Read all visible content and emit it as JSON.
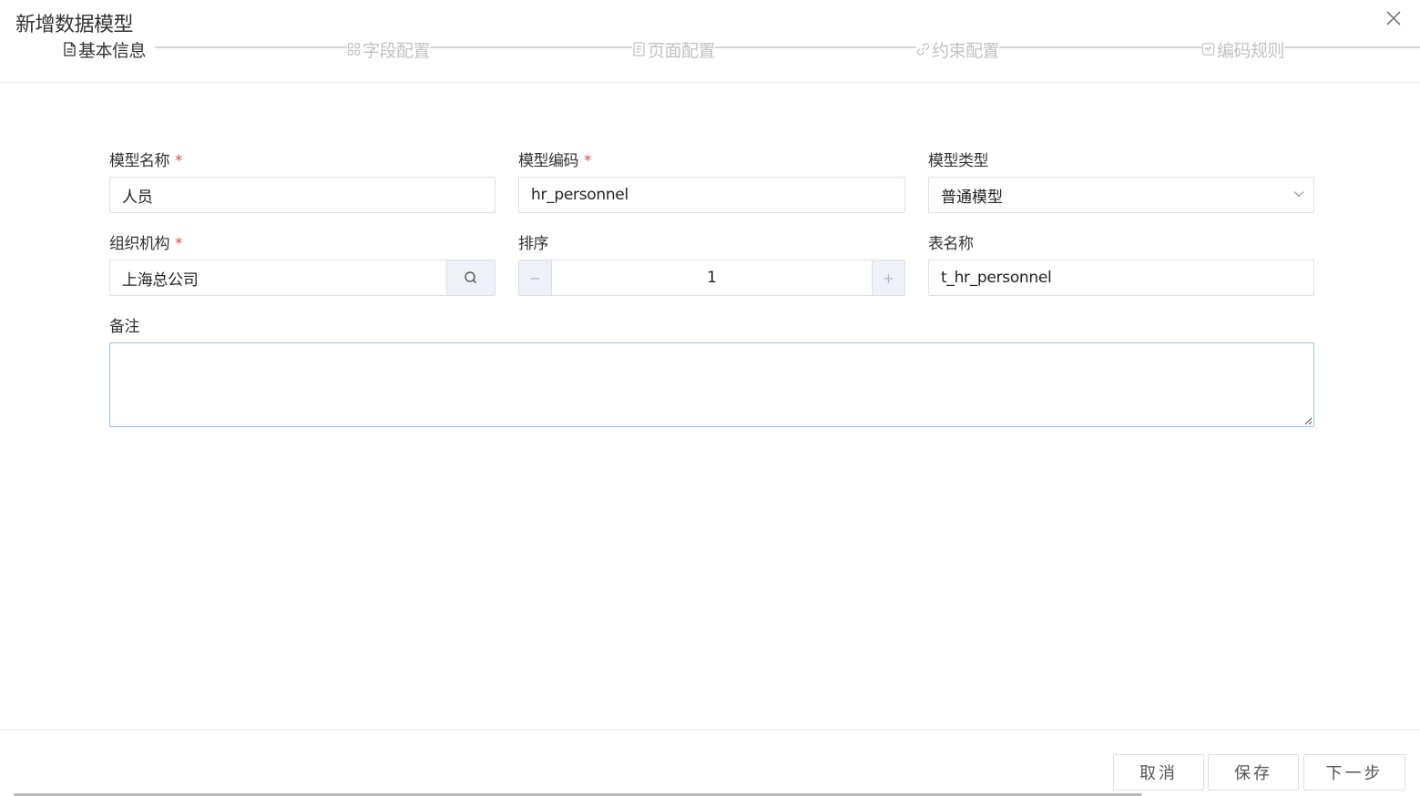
{
  "dialog": {
    "title": "新增数据模型"
  },
  "steps": [
    {
      "label": "基本信息",
      "icon": "document-icon",
      "active": true
    },
    {
      "label": "字段配置",
      "icon": "grid-icon",
      "active": false
    },
    {
      "label": "页面配置",
      "icon": "page-icon",
      "active": false
    },
    {
      "label": "约束配置",
      "icon": "link-icon",
      "active": false
    },
    {
      "label": "编码规则",
      "icon": "code-rule-icon",
      "active": false
    }
  ],
  "form": {
    "model_name": {
      "label": "模型名称",
      "required_mark": "*",
      "value": "人员"
    },
    "model_code": {
      "label": "模型编码",
      "required_mark": "*",
      "value": "hr_personnel"
    },
    "model_type": {
      "label": "模型类型",
      "value": "普通模型"
    },
    "organization": {
      "label": "组织机构",
      "required_mark": "*",
      "value": "上海总公司"
    },
    "sort_order": {
      "label": "排序",
      "value": "1",
      "dec_symbol": "−",
      "inc_symbol": "+"
    },
    "table_name": {
      "label": "表名称",
      "value": "t_hr_personnel"
    },
    "remark": {
      "label": "备注",
      "value": ""
    }
  },
  "footer": {
    "cancel_label": "取消",
    "save_label": "保存",
    "next_label": "下一步"
  }
}
